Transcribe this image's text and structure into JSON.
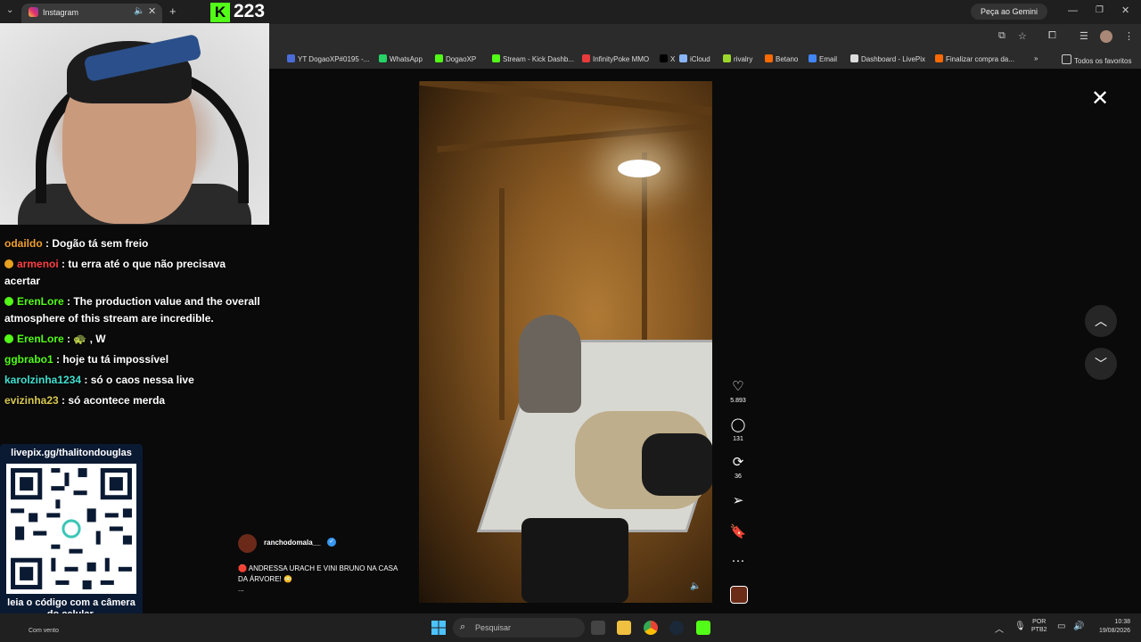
{
  "browser": {
    "tab_title": "Instagram",
    "kick_count": "223",
    "gemini_label": "Peça ao Gemini",
    "bookmarks": [
      {
        "label": "YT DogaoXP#0195 -...",
        "color": "#4a6cd8"
      },
      {
        "label": "WhatsApp",
        "color": "#25d366"
      },
      {
        "label": "DogaoXP",
        "color": "#53fc18"
      },
      {
        "label": "Stream - Kick Dashb...",
        "color": "#53fc18"
      },
      {
        "label": "InfinityPoke MMO",
        "color": "#e83b3b"
      },
      {
        "label": "X",
        "color": "#000000"
      },
      {
        "label": "iCloud",
        "color": "#8ab4f8"
      },
      {
        "label": "rivalry",
        "color": "#9cd82b"
      },
      {
        "label": "Betano",
        "color": "#ff6a00"
      },
      {
        "label": "Email",
        "color": "#4285f4"
      },
      {
        "label": "Dashboard - LivePix",
        "color": "#dddddd"
      },
      {
        "label": "Finalizar compra da...",
        "color": "#ff6a00"
      }
    ],
    "all_bookmarks": "Todos os favoritos"
  },
  "post": {
    "author": "ranchodomala__",
    "caption": "🛑 ANDRESSA URACH E VINI BRUNO NA CASA DA ÁRVORE! 😳",
    "caption_more": "...",
    "likes": "5.893",
    "comments": "131",
    "reposts": "36"
  },
  "chat": [
    {
      "user": "odaildo",
      "color": "#f0a030",
      "text": " : Dogão tá sem freio",
      "badge": null
    },
    {
      "user": "armenoi",
      "color": "#ff4040",
      "text": " : tu erra até o que não precisava acertar",
      "badge": "#e8a020"
    },
    {
      "user": "ErenLore",
      "color": "#53fc18",
      "text": " : The production value and the overall atmosphere of this stream are incredible.",
      "badge": "#53fc18"
    },
    {
      "user": "ErenLore",
      "color": "#53fc18",
      "text": " : 🐢 , W",
      "badge": "#53fc18"
    },
    {
      "user": "ggbrabo1",
      "color": "#53fc18",
      "text": " : hoje tu tá impossível",
      "badge": null
    },
    {
      "user": "karolzinha1234",
      "color": "#40e0d0",
      "text": " : só o caos nessa live",
      "badge": null
    },
    {
      "user": "evizinha23",
      "color": "#d8c850",
      "text": " : só acontece merda",
      "badge": null
    }
  ],
  "qr": {
    "url": "livepix.gg/thalitondouglas",
    "instruction": "leia o código com a câmera do celular."
  },
  "taskbar": {
    "weather": "Com vento",
    "search_placeholder": "Pesquisar",
    "lang_line1": "POR",
    "lang_line2": "PTB2",
    "time": "10:38",
    "date": "19/08/2026"
  }
}
